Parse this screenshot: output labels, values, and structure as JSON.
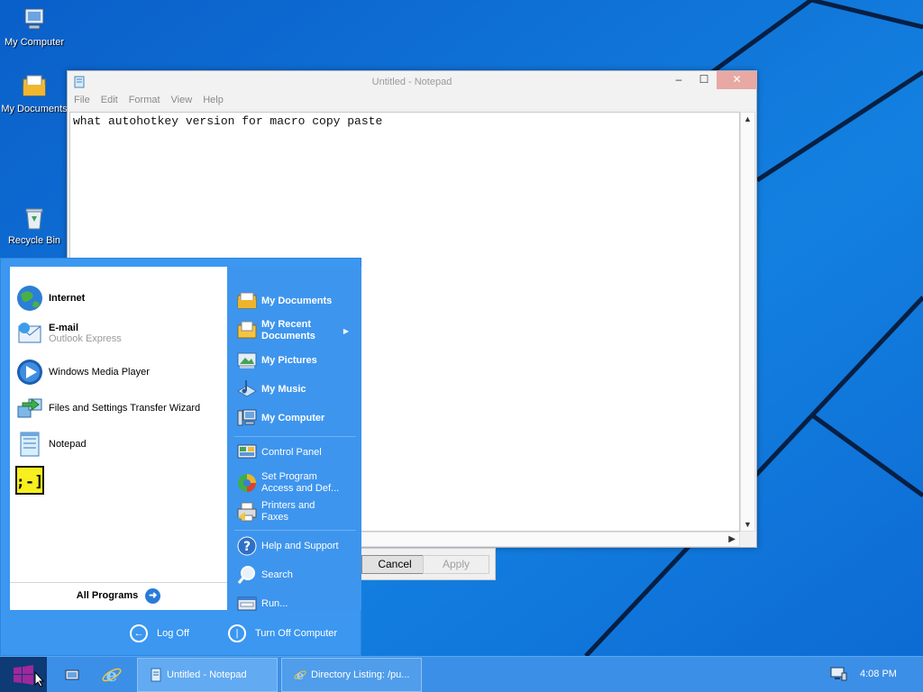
{
  "desktop": {
    "icons": [
      {
        "label": "My Computer",
        "icon": "my-computer-icon"
      },
      {
        "label": "My Documents",
        "icon": "my-documents-icon"
      },
      {
        "label": "Recycle Bin",
        "icon": "recycle-bin-icon"
      }
    ]
  },
  "notepad": {
    "title": "Untitled - Notepad",
    "menu": [
      "File",
      "Edit",
      "Format",
      "View",
      "Help"
    ],
    "content": "what autohotkey version for macro copy paste"
  },
  "dialog": {
    "cancel_label": "Cancel",
    "apply_label": "Apply"
  },
  "start_menu": {
    "left_items": [
      {
        "label": "Internet",
        "sub": "",
        "icon": "internet-globe-icon"
      },
      {
        "label": "E-mail",
        "sub": "Outlook Express",
        "icon": "email-icon"
      },
      {
        "label": "Windows Media Player",
        "sub": "",
        "icon": "media-player-icon"
      },
      {
        "label": "Files and Settings Transfer Wizard",
        "sub": "",
        "icon": "transfer-wizard-icon"
      },
      {
        "label": "Notepad",
        "sub": "",
        "icon": "notepad-icon"
      },
      {
        "label": "",
        "sub": "",
        "icon": "autohotkey-smiley-icon"
      }
    ],
    "all_programs": "All Programs",
    "right_items": [
      {
        "label": "My Documents",
        "icon": "my-documents-icon"
      },
      {
        "label": "My Recent Documents",
        "icon": "recent-documents-icon"
      },
      {
        "label": "My Pictures",
        "icon": "my-pictures-icon"
      },
      {
        "label": "My Music",
        "icon": "my-music-icon"
      },
      {
        "label": "My Computer",
        "icon": "my-computer-icon"
      },
      {
        "label": "Control Panel",
        "icon": "control-panel-icon"
      },
      {
        "label": "Set Program Access and Def...",
        "icon": "set-program-access-icon"
      },
      {
        "label": "Printers and Faxes",
        "icon": "printers-icon"
      },
      {
        "label": "Help and Support",
        "icon": "help-icon"
      },
      {
        "label": "Search",
        "icon": "search-icon"
      },
      {
        "label": "Run...",
        "icon": "run-icon"
      }
    ],
    "log_off": "Log Off",
    "turn_off": "Turn Off Computer"
  },
  "taskbar": {
    "tasks": [
      {
        "label": "Untitled - Notepad",
        "icon": "notepad-icon"
      },
      {
        "label": "Directory Listing: /pu...",
        "icon": "internet-explorer-icon"
      }
    ],
    "clock": "4:08 PM"
  },
  "colors": {
    "wallpaper": "#0f6fd6",
    "start_menu_blue": "#3b97f0",
    "taskbar": "#3c8fe6",
    "start_button": "#0e3a75"
  }
}
